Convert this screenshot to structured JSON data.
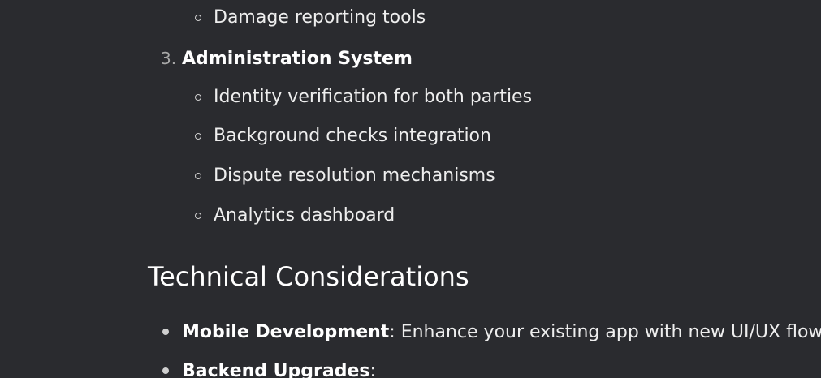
{
  "content": {
    "sub_items_top": [
      {
        "text": "Damage reporting tools"
      }
    ],
    "section3": {
      "marker": "3.",
      "title": "Administration System",
      "sub_items": [
        {
          "text": "Identity verification for both parties"
        },
        {
          "text": "Background checks integration"
        },
        {
          "text": "Dispute resolution mechanisms"
        },
        {
          "text": "Analytics dashboard"
        }
      ]
    },
    "heading": "Technical Considerations",
    "bullets": [
      {
        "label": "Mobile Development",
        "sep": ":",
        "text": " Enhance your existing app with new UI/UX flows"
      },
      {
        "label": "Backend Upgrades",
        "sep": ":",
        "text": ""
      }
    ]
  }
}
